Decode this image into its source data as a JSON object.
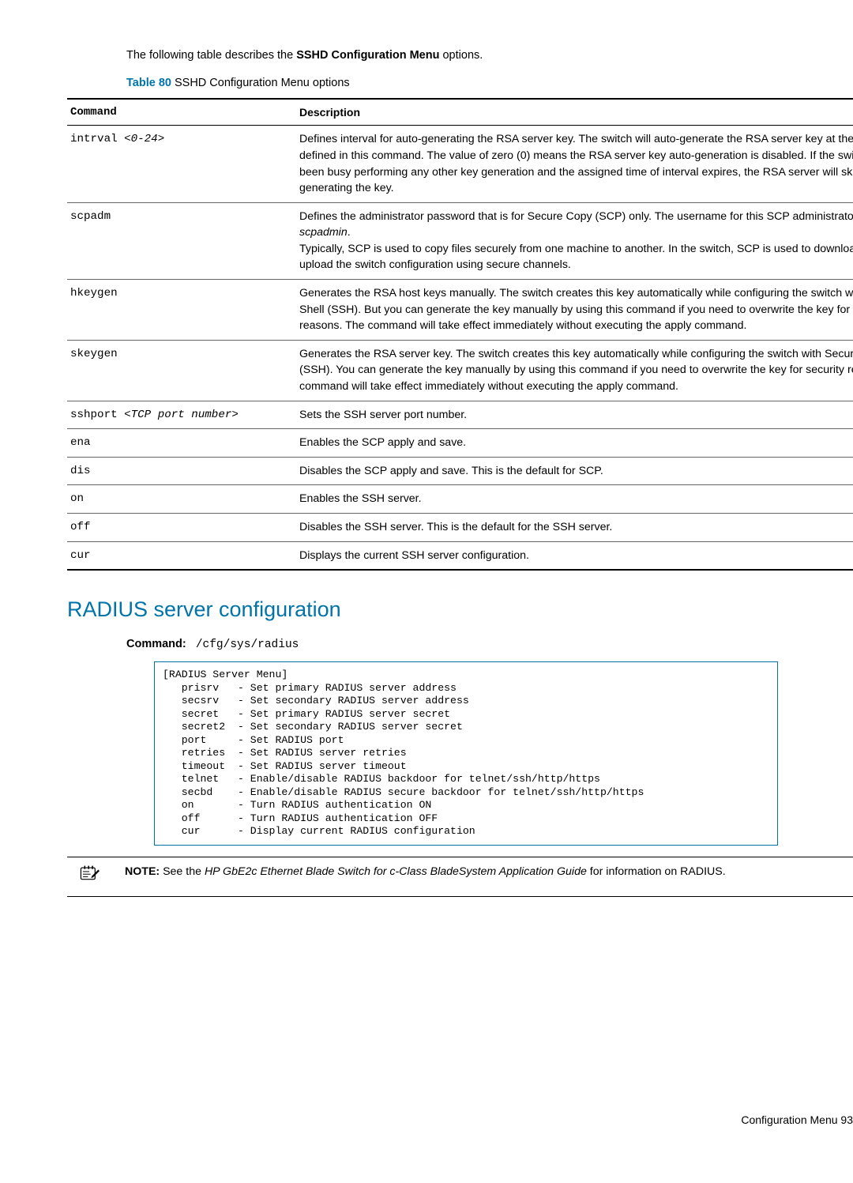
{
  "intro_prefix": "The following table describes the ",
  "intro_bold": "SSHD Configuration Menu",
  "intro_suffix": " options.",
  "table_label": "Table 80",
  "table_title": "  SSHD Configuration Menu options",
  "th_command": "Command",
  "th_description": "Description",
  "rows": [
    {
      "cmd": "intrval ",
      "arg": "<0-24>",
      "desc": "Defines interval for auto-generating the RSA server key. The switch will auto-generate the RSA server key at the interval defined in this command. The value of zero (0) means the RSA server key auto-generation is disabled. If the switch has been busy performing any other key generation and the assigned time of interval expires, the RSA server will skip generating the key."
    },
    {
      "cmd": "scpadm",
      "arg": "",
      "desc_pre": "Defines the administrator password that is for Secure Copy (SCP) only. The username for this SCP administrator is ",
      "desc_em": "scpadmin",
      "desc_post": ".\nTypically, SCP is used to copy files securely from one machine to another. In the switch, SCP is used to download and upload the switch configuration using secure channels."
    },
    {
      "cmd": "hkeygen",
      "arg": "",
      "desc": "Generates the RSA host keys manually. The switch creates this key automatically while configuring the switch with Secure Shell (SSH). But you can generate the key manually by using this command if you need to overwrite the key for security reasons. The command will take effect immediately without executing the apply command."
    },
    {
      "cmd": "skeygen",
      "arg": "",
      "desc": "Generates the RSA server key. The switch creates this key automatically while configuring the switch with Secure Shell (SSH). You can generate the key manually by using this command if you need to overwrite the key for security reasons. The command will take effect immediately without executing the apply command."
    },
    {
      "cmd": "sshport ",
      "arg": "<TCP port number>",
      "desc": "Sets the SSH server port number."
    },
    {
      "cmd": "ena",
      "arg": "",
      "desc": "Enables the SCP apply and save."
    },
    {
      "cmd": "dis",
      "arg": "",
      "desc": "Disables the SCP apply and save. This is the default for SCP."
    },
    {
      "cmd": "on",
      "arg": "",
      "desc": "Enables the SSH server."
    },
    {
      "cmd": "off",
      "arg": "",
      "desc": "Disables the SSH server. This is the default for the SSH server."
    },
    {
      "cmd": "cur",
      "arg": "",
      "desc": "Displays the current SSH server configuration."
    }
  ],
  "section_title": "RADIUS server configuration",
  "cmd_label": "Command:",
  "cmd_path": "/cfg/sys/radius",
  "menu_text": "[RADIUS Server Menu]\n   prisrv   - Set primary RADIUS server address\n   secsrv   - Set secondary RADIUS server address\n   secret   - Set primary RADIUS server secret\n   secret2  - Set secondary RADIUS server secret\n   port     - Set RADIUS port\n   retries  - Set RADIUS server retries\n   timeout  - Set RADIUS server timeout\n   telnet   - Enable/disable RADIUS backdoor for telnet/ssh/http/https\n   secbd    - Enable/disable RADIUS secure backdoor for telnet/ssh/http/https\n   on       - Turn RADIUS authentication ON\n   off      - Turn RADIUS authentication OFF\n   cur      - Display current RADIUS configuration",
  "note_label": "NOTE:",
  "note_pre": "  See the ",
  "note_em": "HP GbE2c Ethernet Blade Switch for c-Class BladeSystem Application Guide",
  "note_post": " for information on RADIUS.",
  "footer_text": "Configuration Menu   93"
}
